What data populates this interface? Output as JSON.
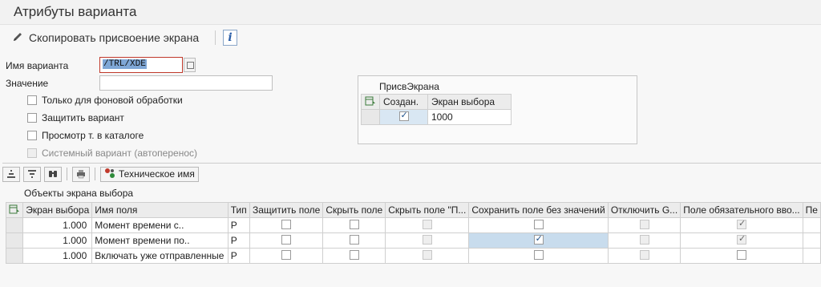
{
  "title": "Атрибуты варианта",
  "toolbar": {
    "copy_label": "Скопировать присвоение экрана",
    "info_label": "i"
  },
  "form": {
    "variant_label": "Имя варианта",
    "variant_value": "/TRL/XDE",
    "value_label": "Значение",
    "value_value": "",
    "checkboxes": [
      {
        "label": "Только для фоновой обработки",
        "checked": false,
        "disabled": false
      },
      {
        "label": "Защитить вариант",
        "checked": false,
        "disabled": false
      },
      {
        "label": "Просмотр т. в каталоге",
        "checked": false,
        "disabled": false
      },
      {
        "label": "Системный вариант (автоперенос)",
        "checked": false,
        "disabled": true
      }
    ]
  },
  "assign": {
    "caption": "ПрисвЭкрана",
    "headers": [
      "Создан.",
      "Экран выбора"
    ],
    "row": {
      "created": true,
      "screen": "1000"
    }
  },
  "grid_tools": {
    "tech_name_label": "Техническое имя"
  },
  "grid": {
    "caption": "Объекты экрана выбора",
    "headers": [
      "Экран выбора",
      "Имя поля",
      "Тип",
      "Защитить поле",
      "Скрыть поле",
      "Скрыть поле \"П...",
      "Сохранить поле без значений",
      "Отключить G...",
      "Поле обязательного вво...",
      "Пе"
    ],
    "rows": [
      {
        "screen": "1.000",
        "field": "Момент времени с..",
        "type": "P",
        "protect": false,
        "hide": false,
        "hide_p": false,
        "save_empty": false,
        "disable_g": false,
        "required": true
      },
      {
        "screen": "1.000",
        "field": "Момент времени по..",
        "type": "P",
        "protect": false,
        "hide": false,
        "hide_p": false,
        "save_empty": true,
        "disable_g": false,
        "required": true
      },
      {
        "screen": "1.000",
        "field": "Включать уже отправленные",
        "type": "P",
        "protect": false,
        "hide": false,
        "hide_p": false,
        "save_empty": false,
        "disable_g": false,
        "required": false
      }
    ]
  }
}
